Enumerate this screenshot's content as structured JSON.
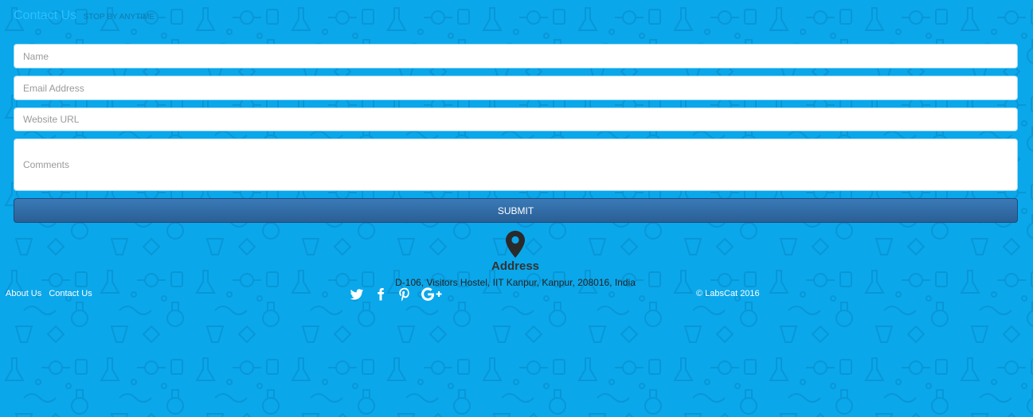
{
  "contact": {
    "title": "Contact Us",
    "subtitle": "STOP BY ANYTIME"
  },
  "form": {
    "name_placeholder": "Name",
    "email_placeholder": "Email Address",
    "url_placeholder": "Website URL",
    "comments_placeholder": "Comments",
    "submit_label": "SUBMIT"
  },
  "address": {
    "icon": "map-marker-icon",
    "title": "Address",
    "text": "D-106, Visitors Hostel, IIT Kanpur, Kanpur, 208016, India"
  },
  "footer": {
    "links": [
      "About Us",
      "Contact Us"
    ],
    "social_icons": [
      "twitter-icon",
      "facebook-icon",
      "pinterest-icon",
      "google-plus-icon"
    ],
    "copyright": "© LabsCat 2016"
  },
  "colors": {
    "background": "#0aa7eb",
    "title": "#2cc0ff",
    "button": "#2f6aa5"
  }
}
